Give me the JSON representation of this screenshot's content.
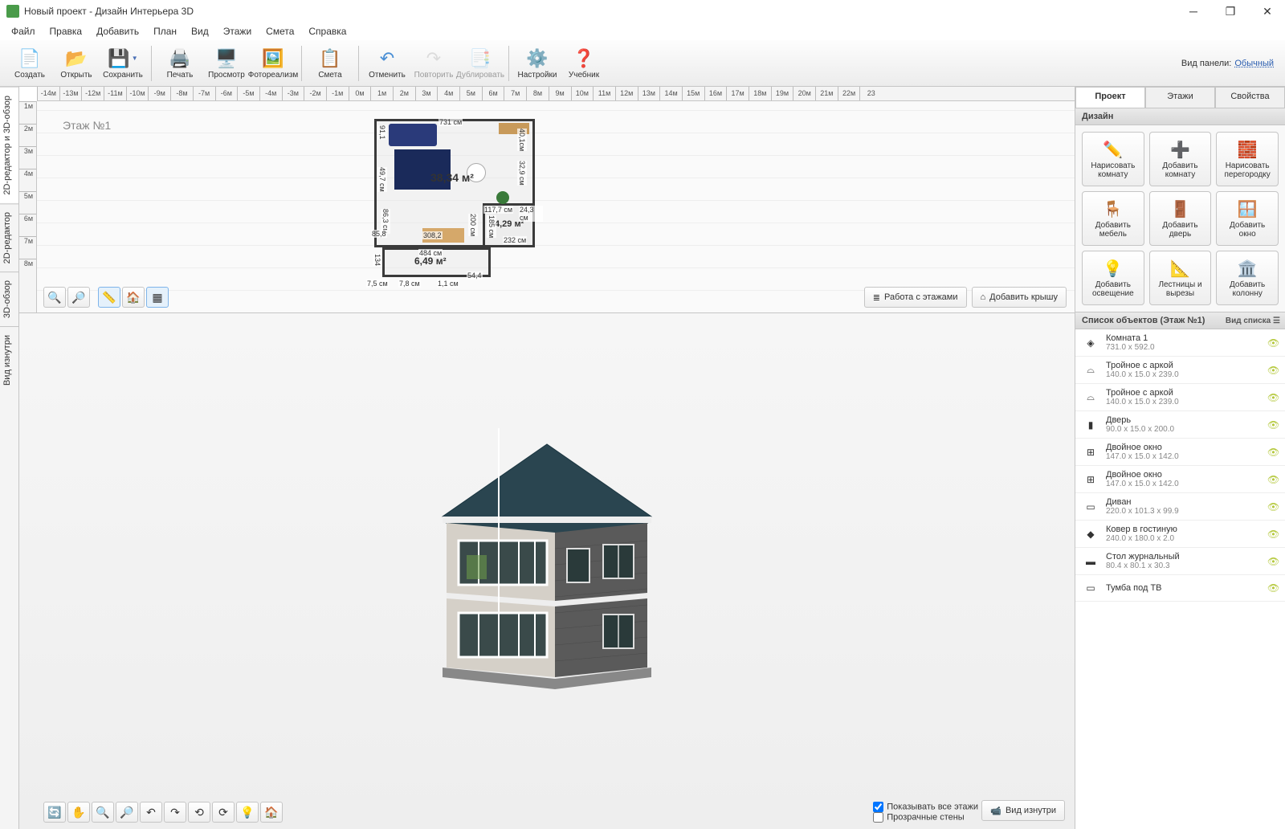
{
  "title": "Новый проект - Дизайн Интерьера 3D",
  "menu": [
    "Файл",
    "Правка",
    "Добавить",
    "План",
    "Вид",
    "Этажи",
    "Смета",
    "Справка"
  ],
  "toolbar": [
    {
      "label": "Создать",
      "icon": "file",
      "color": "#f5d47a"
    },
    {
      "label": "Открыть",
      "icon": "folder",
      "color": "#f5b547"
    },
    {
      "label": "Сохранить",
      "icon": "save",
      "color": "#4a6fb5",
      "dropdown": true,
      "sep": true
    },
    {
      "label": "Печать",
      "icon": "print",
      "color": "#888"
    },
    {
      "label": "Просмотр",
      "icon": "monitor",
      "color": "#4a8fd5"
    },
    {
      "label": "Фотореализм",
      "icon": "photo",
      "color": "#c58a5a",
      "sep": true
    },
    {
      "label": "Смета",
      "icon": "doc",
      "color": "#e5c05a",
      "sep": true
    },
    {
      "label": "Отменить",
      "icon": "undo",
      "color": "#4a8fd5"
    },
    {
      "label": "Повторить",
      "icon": "redo",
      "color": "#bbb",
      "disabled": true
    },
    {
      "label": "Дублировать",
      "icon": "copy",
      "color": "#bbb",
      "disabled": true,
      "sep": true
    },
    {
      "label": "Настройки",
      "icon": "gear",
      "color": "#4a8fd5"
    },
    {
      "label": "Учебник",
      "icon": "help",
      "color": "#4a8fd5"
    }
  ],
  "panel_mode": {
    "label": "Вид панели:",
    "value": "Обычный"
  },
  "vtabs": [
    "2D-редактор и 3D-обзор",
    "2D-редактор",
    "3D-обзор",
    "Вид изнутри"
  ],
  "ruler_h": [
    "-14м",
    "-13м",
    "-12м",
    "-11м",
    "-10м",
    "-9м",
    "-8м",
    "-7м",
    "-6м",
    "-5м",
    "-4м",
    "-3м",
    "-2м",
    "-1м",
    "0м",
    "1м",
    "2м",
    "3м",
    "4м",
    "5м",
    "6м",
    "7м",
    "8м",
    "9м",
    "10м",
    "11м",
    "12м",
    "13м",
    "14м",
    "15м",
    "16м",
    "17м",
    "18м",
    "19м",
    "20м",
    "21м",
    "22м",
    "23"
  ],
  "ruler_v": [
    "1м",
    "2м",
    "3м",
    "4м",
    "5м",
    "6м",
    "7м",
    "8м"
  ],
  "floor_label": "Этаж №1",
  "floorplan": {
    "areas": {
      "main": "38,34 м²",
      "hall": "4,29 м²",
      "entry": "6,49 м²"
    },
    "dims": {
      "top": "731 см",
      "right1": "40,1см",
      "right2": "32,9 см",
      "left": "49,7 см",
      "left2": "91,1",
      "mid": "117,7 см",
      "mid2": "24,3 см",
      "bath_h": "200 см",
      "bath_w": "232 см",
      "bath_l": "185 см",
      "door": "308,2",
      "bl": "86,3 см",
      "bl2": "85,8",
      "bl3": "134",
      "balc": "484 см",
      "b1": "7,5 см",
      "b2": "7,8 см",
      "b3": "1,1 см",
      "b4": "54,4"
    }
  },
  "view2d_actions": {
    "floors": "Работа с этажами",
    "roof": "Добавить крышу"
  },
  "view3d_opts": {
    "all_floors": "Показывать все этажи",
    "transparent": "Прозрачные стены",
    "inside": "Вид изнутри"
  },
  "rtabs": [
    "Проект",
    "Этажи",
    "Свойства"
  ],
  "design_header": "Дизайн",
  "design_buttons": [
    {
      "l1": "Нарисовать",
      "l2": "комнату",
      "ico": "✏️"
    },
    {
      "l1": "Добавить",
      "l2": "комнату",
      "ico": "➕"
    },
    {
      "l1": "Нарисовать",
      "l2": "перегородку",
      "ico": "🧱"
    },
    {
      "l1": "Добавить",
      "l2": "мебель",
      "ico": "🪑"
    },
    {
      "l1": "Добавить",
      "l2": "дверь",
      "ico": "🚪"
    },
    {
      "l1": "Добавить",
      "l2": "окно",
      "ico": "🪟"
    },
    {
      "l1": "Добавить",
      "l2": "освещение",
      "ico": "💡"
    },
    {
      "l1": "Лестницы и",
      "l2": "вырезы",
      "ico": "📐"
    },
    {
      "l1": "Добавить",
      "l2": "колонну",
      "ico": "🏛️"
    }
  ],
  "objects_header": "Список объектов (Этаж №1)",
  "objects_viewmode": "Вид списка",
  "objects": [
    {
      "name": "Комната 1",
      "dim": "731.0 x 592.0",
      "ico": "◈"
    },
    {
      "name": "Тройное с аркой",
      "dim": "140.0 x 15.0 x 239.0",
      "ico": "⌓"
    },
    {
      "name": "Тройное с аркой",
      "dim": "140.0 x 15.0 x 239.0",
      "ico": "⌓"
    },
    {
      "name": "Дверь",
      "dim": "90.0 x 15.0 x 200.0",
      "ico": "▮"
    },
    {
      "name": "Двойное окно",
      "dim": "147.0 x 15.0 x 142.0",
      "ico": "⊞"
    },
    {
      "name": "Двойное окно",
      "dim": "147.0 x 15.0 x 142.0",
      "ico": "⊞"
    },
    {
      "name": "Диван",
      "dim": "220.0 x 101.3 x 99.9",
      "ico": "▭"
    },
    {
      "name": "Ковер в гостиную",
      "dim": "240.0 x 180.0 x 2.0",
      "ico": "◆"
    },
    {
      "name": "Стол журнальный",
      "dim": "80.4 x 80.1 x 30.3",
      "ico": "▬"
    },
    {
      "name": "Тумба под ТВ",
      "dim": "",
      "ico": "▭"
    }
  ]
}
